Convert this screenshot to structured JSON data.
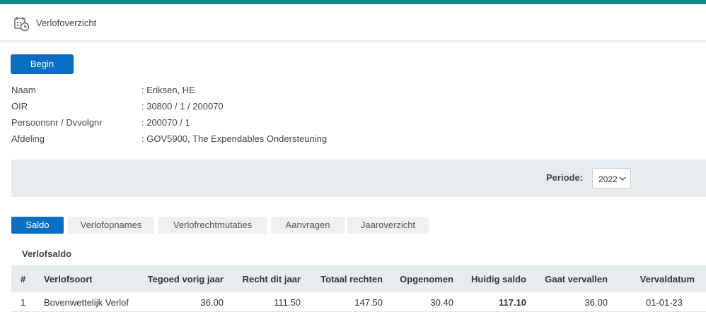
{
  "header": {
    "title": "Verlofoverzicht",
    "icon": "calendar-clock-icon"
  },
  "begin_button": "Begin",
  "info": [
    {
      "label": "Naam",
      "value": ": Eriksen, HE"
    },
    {
      "label": "OIR",
      "value": ": 30800 / 1 / 200070"
    },
    {
      "label": "Persoonsnr / Dvvolgnr",
      "value": ": 200070 / 1"
    },
    {
      "label": "Afdeling",
      "value": ": GOV5900, The Expendables Ondersteuning"
    }
  ],
  "periode": {
    "label": "Periode:",
    "value": "2022"
  },
  "tabs": [
    "Saldo",
    "Verlofopnames",
    "Verlofrechtmutaties",
    "Aanvragen",
    "Jaaroverzicht"
  ],
  "active_tab": "Saldo",
  "section_title": "Verlofsaldo",
  "table": {
    "headers": [
      "#",
      "Verlofsoort",
      "Tegoed vorig jaar",
      "Recht dit jaar",
      "Totaal rechten",
      "Opgenomen",
      "Huidig saldo",
      "Gaat vervallen",
      "Vervaldatum"
    ],
    "rows": [
      [
        "1",
        "Bovenwettelijk Verlof",
        "36.00",
        "111.50",
        "147.50",
        "30.40",
        "117.10",
        "36.00",
        "01-01-23"
      ]
    ]
  },
  "colors": {
    "accent": "#0a6fc2",
    "topbar": "#0d8a8a",
    "panel": "#e9ecef"
  }
}
